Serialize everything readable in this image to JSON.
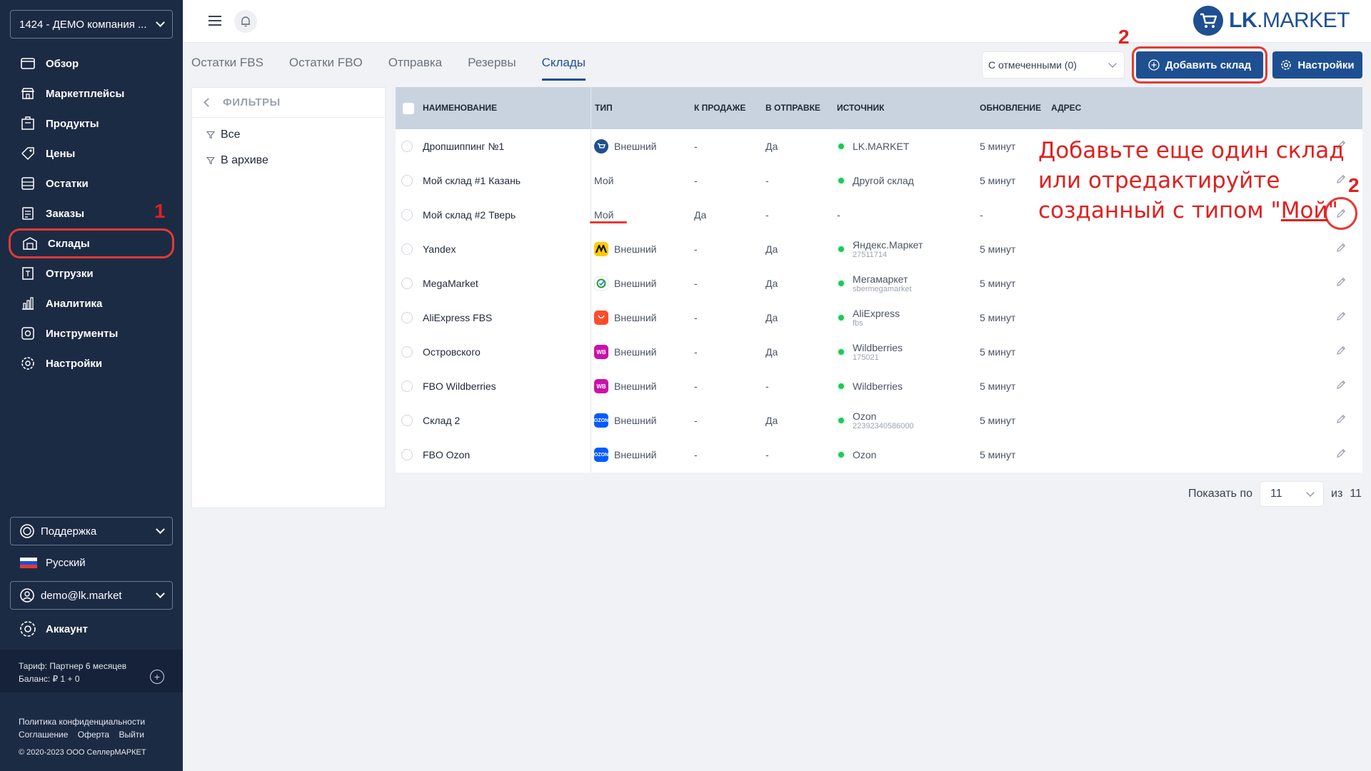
{
  "sidebar": {
    "company": "1424 - ДЕМО компания ...",
    "nav": [
      {
        "label": "Обзор",
        "icon": "overview-icon"
      },
      {
        "label": "Маркетплейсы",
        "icon": "marketplaces-icon"
      },
      {
        "label": "Продукты",
        "icon": "products-icon"
      },
      {
        "label": "Цены",
        "icon": "prices-icon"
      },
      {
        "label": "Остатки",
        "icon": "stock-icon"
      },
      {
        "label": "Заказы",
        "icon": "orders-icon"
      },
      {
        "label": "Склады",
        "icon": "warehouse-icon"
      },
      {
        "label": "Отгрузки",
        "icon": "shipments-icon"
      },
      {
        "label": "Аналитика",
        "icon": "analytics-icon"
      },
      {
        "label": "Инструменты",
        "icon": "tools-icon"
      },
      {
        "label": "Настройки",
        "icon": "settings-icon"
      }
    ],
    "support": "Поддержка",
    "language": "Русский",
    "user": "demo@lk.market",
    "account": "Аккаунт",
    "tariff": "Тариф: Партнер 6 месяцев",
    "balance": "Баланс: ₽ 1 + 0",
    "privacy": "Политика конфиденциальности",
    "agreement": "Соглашение",
    "offer": "Оферта",
    "logout": "Выйти",
    "copyright": "© 2020-2023 ООО СеллерМАРКЕТ"
  },
  "header": {
    "logo_bold": "LK",
    "logo_rest": ".MARKET"
  },
  "tabs": [
    "Остатки FBS",
    "Остатки FBO",
    "Отправка",
    "Резервы",
    "Склады"
  ],
  "toolbar": {
    "with_selected": "С отмеченными (0)",
    "add_warehouse": "Добавить склад",
    "settings": "Настройки"
  },
  "filters": {
    "title": "ФИЛЬТРЫ",
    "all": "Все",
    "archive": "В архиве"
  },
  "table": {
    "headers": {
      "name": "НАИМЕНОВАНИЕ",
      "type": "ТИП",
      "for_sale": "К ПРОДАЖЕ",
      "in_shipment": "В ОТПРАВКЕ",
      "source": "ИСТОЧНИК",
      "update": "ОБНОВЛЕНИЕ",
      "address": "АДРЕС"
    },
    "rows": [
      {
        "name": "Дропшиппинг №1",
        "type": "Внешний",
        "mp": "lkmarket",
        "sale": "-",
        "ship": "Да",
        "source": "LK.MARKET",
        "source_sub": "",
        "dot": true,
        "update": "5 минут"
      },
      {
        "name": "Мой склад #1 Казань",
        "type": "Мой",
        "mp": "",
        "sale": "-",
        "ship": "-",
        "source": "Другой склад",
        "source_sub": "",
        "dot": true,
        "update": "5 минут"
      },
      {
        "name": "Мой склад #2 Тверь",
        "type": "Мой",
        "mp": "",
        "sale": "Да",
        "ship": "-",
        "source": "-",
        "source_sub": "",
        "dot": false,
        "update": "-"
      },
      {
        "name": "Yandex",
        "type": "Внешний",
        "mp": "yandex",
        "sale": "-",
        "ship": "Да",
        "source": "Яндекс.Маркет",
        "source_sub": "27511714",
        "dot": true,
        "update": "5 минут"
      },
      {
        "name": "MegaMarket",
        "type": "Внешний",
        "mp": "mega",
        "sale": "-",
        "ship": "Да",
        "source": "Мегамаркет",
        "source_sub": "sbermegamarket",
        "dot": true,
        "update": "5 минут"
      },
      {
        "name": "AliExpress FBS",
        "type": "Внешний",
        "mp": "ali",
        "sale": "-",
        "ship": "Да",
        "source": "AliExpress",
        "source_sub": "fbs",
        "dot": true,
        "update": "5 минут"
      },
      {
        "name": "Островского",
        "type": "Внешний",
        "mp": "wb",
        "sale": "-",
        "ship": "Да",
        "source": "Wildberries",
        "source_sub": "175021",
        "dot": true,
        "update": "5 минут"
      },
      {
        "name": "FBO Wildberries",
        "type": "Внешний",
        "mp": "wb",
        "sale": "-",
        "ship": "-",
        "source": "Wildberries",
        "source_sub": "",
        "dot": true,
        "update": "5 минут"
      },
      {
        "name": "Склад 2",
        "type": "Внешний",
        "mp": "ozon",
        "sale": "-",
        "ship": "Да",
        "source": "Ozon",
        "source_sub": "22392340586000",
        "dot": true,
        "update": "5 минут"
      },
      {
        "name": "FBO Ozon",
        "type": "Внешний",
        "mp": "ozon",
        "sale": "-",
        "ship": "-",
        "source": "Ozon",
        "source_sub": "",
        "dot": true,
        "update": "5 минут"
      }
    ]
  },
  "pagination": {
    "show_label": "Показать по",
    "per_page": "11",
    "of_label": "из",
    "total": "11"
  },
  "annotations": {
    "num1": "1",
    "num2_button": "2",
    "num2_pencil": "2",
    "line1": "Добавьте еще один склад",
    "line2": "или отредактируйте",
    "line3_prefix": "созданный с типом \"",
    "line3_word": "Мой",
    "line3_suffix": "\""
  }
}
